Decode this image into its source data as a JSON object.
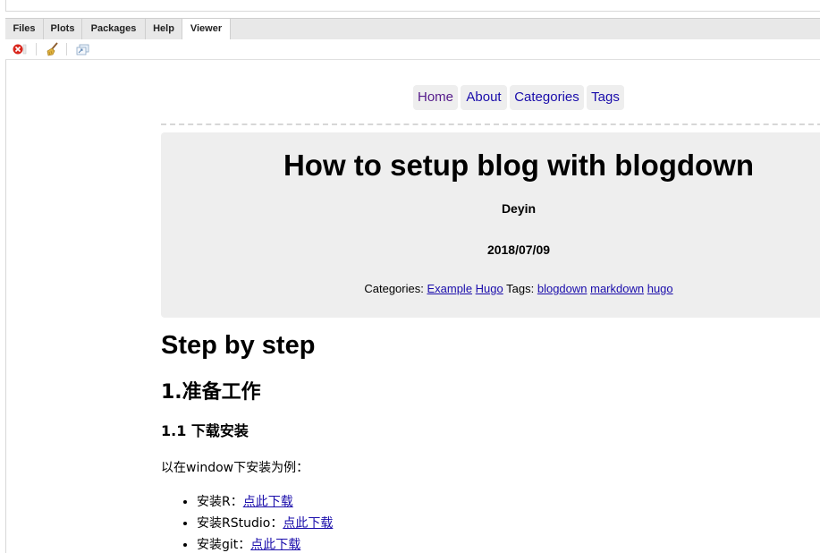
{
  "tabs": [
    "Files",
    "Plots",
    "Packages",
    "Help",
    "Viewer"
  ],
  "active_tab": "Viewer",
  "toolbar": {
    "icons": [
      "clear-close-icon",
      "broom-icon",
      "popout-icon"
    ]
  },
  "site_nav": {
    "home": "Home",
    "about": "About",
    "categories": "Categories",
    "tags": "Tags"
  },
  "post": {
    "title": "How to setup blog with blogdown",
    "author": "Deyin",
    "date": "2018/07/09",
    "categories_label": "Categories:",
    "categories": [
      "Example",
      "Hugo"
    ],
    "tags_label": "Tags:",
    "tags": [
      "blogdown",
      "markdown",
      "hugo"
    ]
  },
  "content": {
    "h1": "Step by step",
    "h2": "1.准备工作",
    "h3": "1.1 下载安装",
    "intro": "以在window下安装为例：",
    "items": [
      {
        "prefix": "安装R：",
        "link": "点此下载"
      },
      {
        "prefix": "安装RStudio：",
        "link": "点此下载"
      },
      {
        "prefix": "安装git：",
        "link": "点此下载"
      }
    ]
  },
  "colors": {
    "link": "#1a0dab",
    "visited": "#551a8b",
    "header_bg": "#eeeeee",
    "tabbar_bg": "#e8e8e8",
    "close_icon": "#d9261c"
  }
}
